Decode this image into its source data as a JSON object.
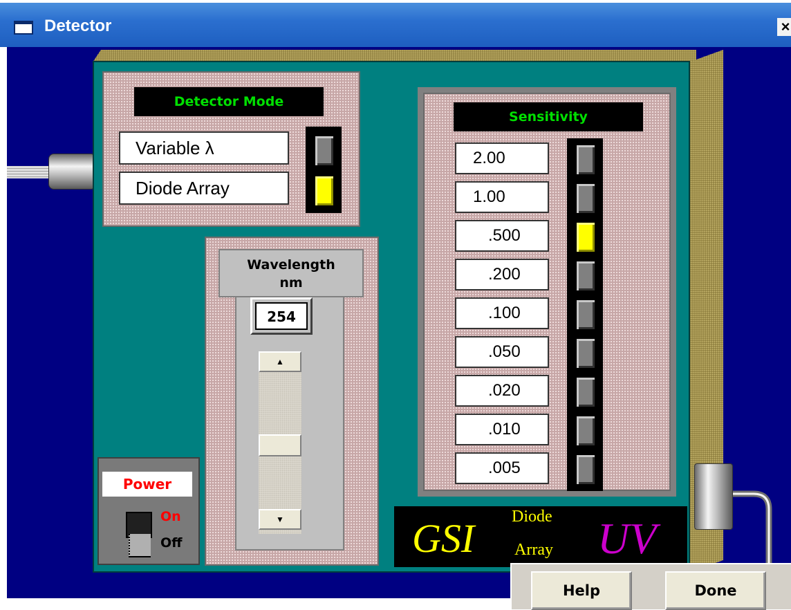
{
  "window": {
    "title": "Detector",
    "close_symbol": "×"
  },
  "detector_mode": {
    "title": "Detector Mode",
    "options": [
      {
        "label": "Variable λ",
        "selected": false
      },
      {
        "label": "Diode Array",
        "selected": true
      }
    ]
  },
  "wavelength": {
    "title_line1": "Wavelength",
    "title_line2": "nm",
    "value": "254",
    "scroll_up": "▲",
    "scroll_down": "▼"
  },
  "power": {
    "label": "Power",
    "on_label": "On",
    "off_label": "Off",
    "state": "on"
  },
  "sensitivity": {
    "title": "Sensitivity",
    "options": [
      {
        "label": "2.00",
        "selected": false
      },
      {
        "label": "1.00",
        "selected": false
      },
      {
        "label": ".500",
        "selected": true
      },
      {
        "label": ".200",
        "selected": false
      },
      {
        "label": ".100",
        "selected": false
      },
      {
        "label": ".050",
        "selected": false
      },
      {
        "label": ".020",
        "selected": false
      },
      {
        "label": ".010",
        "selected": false
      },
      {
        "label": ".005",
        "selected": false
      }
    ]
  },
  "logo": {
    "brand": "GSI",
    "line1": "Diode",
    "line2": "Array",
    "suffix": "UV"
  },
  "buttons": {
    "help": "Help",
    "done": "Done"
  },
  "colors": {
    "background": "#000082",
    "panel": "#008080",
    "indicator_on": "#ffff00",
    "label_green": "#00e000",
    "power_red": "#ff0000",
    "uv_magenta": "#cc00cc"
  }
}
